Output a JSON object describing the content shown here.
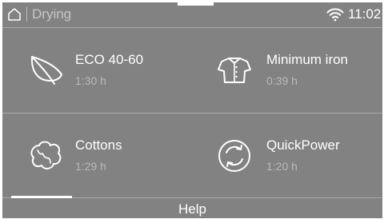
{
  "status_bar": {
    "title": "Drying",
    "time": "11:02",
    "home_icon": "home-icon",
    "wifi_icon": "wifi-icon"
  },
  "programs": [
    {
      "name": "ECO 40-60",
      "duration": "1:30  h",
      "icon": "leaf-icon"
    },
    {
      "name": "Minimum iron",
      "duration": "0:39  h",
      "icon": "shirt-icon"
    },
    {
      "name": "Cottons",
      "duration": "1:29  h",
      "icon": "cotton-icon"
    },
    {
      "name": "QuickPower",
      "duration": "1:20  h",
      "icon": "quickpower-icon"
    }
  ],
  "footer": {
    "help_label": "Help"
  },
  "colors": {
    "background": "#828282",
    "text_primary": "#ffffff",
    "text_secondary": "#b9b9b9"
  }
}
